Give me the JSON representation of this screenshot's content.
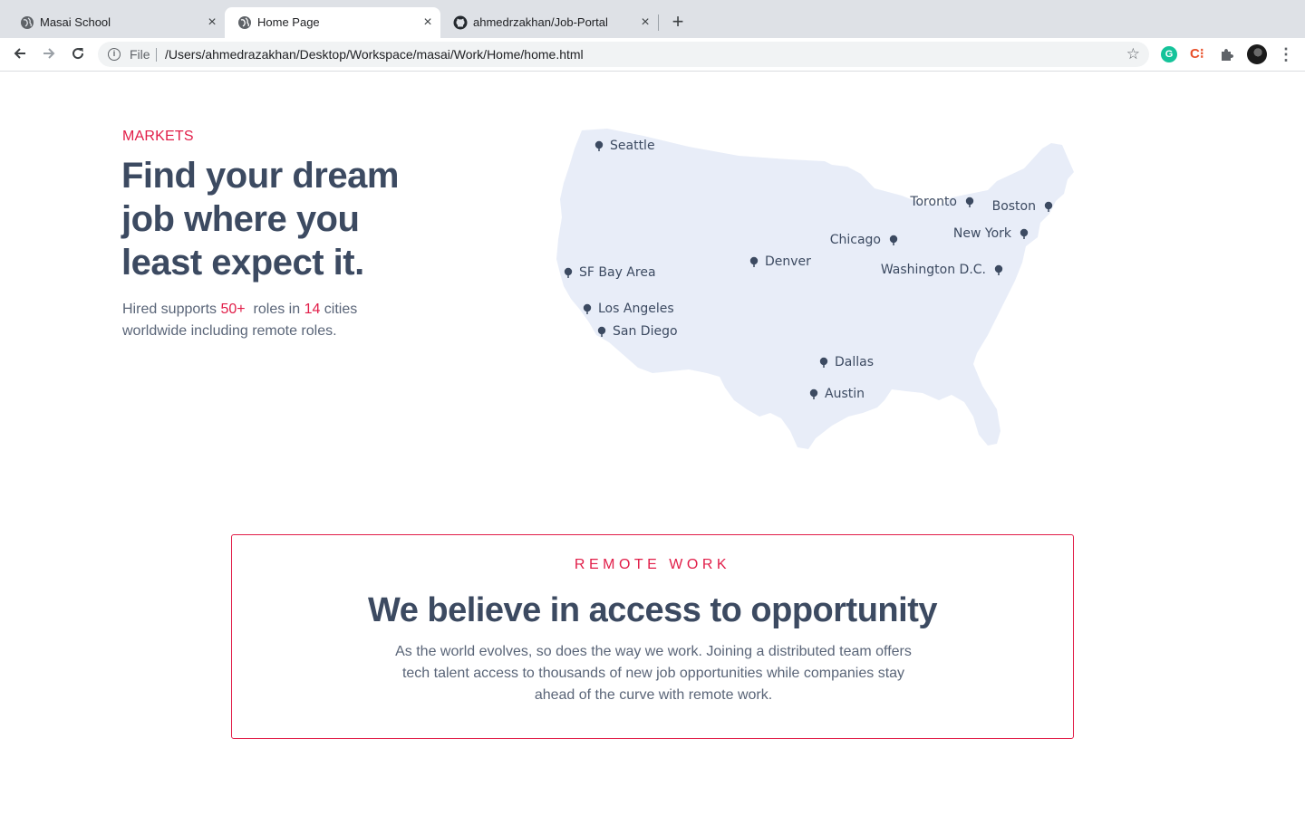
{
  "browser": {
    "tabs": [
      {
        "title": "Masai School",
        "active": false
      },
      {
        "title": "Home Page",
        "active": true
      },
      {
        "title": "ahmedrzakhan/Job-Portal",
        "active": false
      }
    ],
    "close_glyph": "×",
    "new_tab_glyph": "+",
    "omnibox": {
      "scheme_label": "File",
      "url": "/Users/ahmedrazakhan/Desktop/Workspace/masai/Work/Home/home.html"
    },
    "extensions": [
      "grammarly-icon",
      "c-extension-icon",
      "puzzle-icon",
      "profile-avatar"
    ]
  },
  "markets": {
    "eyebrow": "MARKETS",
    "title": "Find your dream job where you least expect it.",
    "desc_prefix": "Hired supports ",
    "roles_count": "50+",
    "desc_mid": "  roles in ",
    "cities_count": "14",
    "desc_suffix": " cities worldwide including remote roles."
  },
  "map": {
    "fill_color": "#e8edf8",
    "pin_color": "#3c4a61",
    "cities": [
      "Seattle",
      "Toronto",
      "Boston",
      "New York",
      "Chicago",
      "Denver",
      "Washington D.C.",
      "SF Bay Area",
      "Los Angeles",
      "San Diego",
      "Dallas",
      "Austin"
    ]
  },
  "remote": {
    "eyebrow": "REMOTE WORK",
    "title": "We believe in access to opportunity",
    "description": "As the world evolves, so does the way we work. Joining a distributed team offers tech talent access to thousands of new job opportunities while companies stay ahead of the curve with remote work."
  },
  "colors": {
    "accent": "#e11d48",
    "heading": "#3c4a61",
    "body": "#5a6578"
  }
}
